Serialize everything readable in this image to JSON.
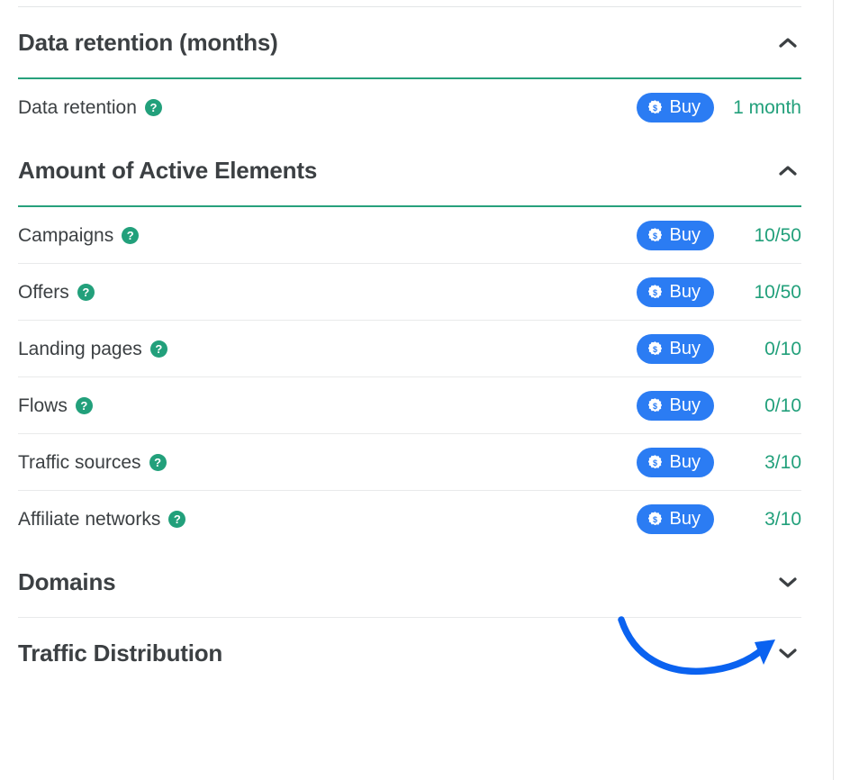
{
  "colors": {
    "accent_blue": "#2b7cf3",
    "value_green": "#22a07b",
    "divider_green": "#27a17c",
    "title_gray": "#3c4043",
    "arrow_blue": "#0a62f0"
  },
  "sections": [
    {
      "title": "Data retention (months)",
      "expanded": true,
      "chevron_icon": "chevron-up-icon",
      "rows": [
        {
          "label": "Data retention",
          "help_icon": "help-circle-icon",
          "buy_label": "Buy",
          "buy_icon": "coin-dollar-icon",
          "value": "1 month"
        }
      ]
    },
    {
      "title": "Amount of Active Elements",
      "expanded": true,
      "chevron_icon": "chevron-up-icon",
      "rows": [
        {
          "label": "Campaigns",
          "help_icon": "help-circle-icon",
          "buy_label": "Buy",
          "buy_icon": "coin-dollar-icon",
          "value": "10/50"
        },
        {
          "label": "Offers",
          "help_icon": "help-circle-icon",
          "buy_label": "Buy",
          "buy_icon": "coin-dollar-icon",
          "value": "10/50"
        },
        {
          "label": "Landing pages",
          "help_icon": "help-circle-icon",
          "buy_label": "Buy",
          "buy_icon": "coin-dollar-icon",
          "value": "0/10"
        },
        {
          "label": "Flows",
          "help_icon": "help-circle-icon",
          "buy_label": "Buy",
          "buy_icon": "coin-dollar-icon",
          "value": "0/10"
        },
        {
          "label": "Traffic sources",
          "help_icon": "help-circle-icon",
          "buy_label": "Buy",
          "buy_icon": "coin-dollar-icon",
          "value": "3/10"
        },
        {
          "label": "Affiliate networks",
          "help_icon": "help-circle-icon",
          "buy_label": "Buy",
          "buy_icon": "coin-dollar-icon",
          "value": "3/10"
        }
      ]
    },
    {
      "title": "Domains",
      "expanded": false,
      "chevron_icon": "chevron-down-icon",
      "rows": []
    },
    {
      "title": "Traffic Distribution",
      "expanded": false,
      "chevron_icon": "chevron-down-icon",
      "rows": []
    }
  ],
  "annotation": {
    "icon": "curved-arrow-icon",
    "points_to": "Domains"
  },
  "help_glyph": "?"
}
